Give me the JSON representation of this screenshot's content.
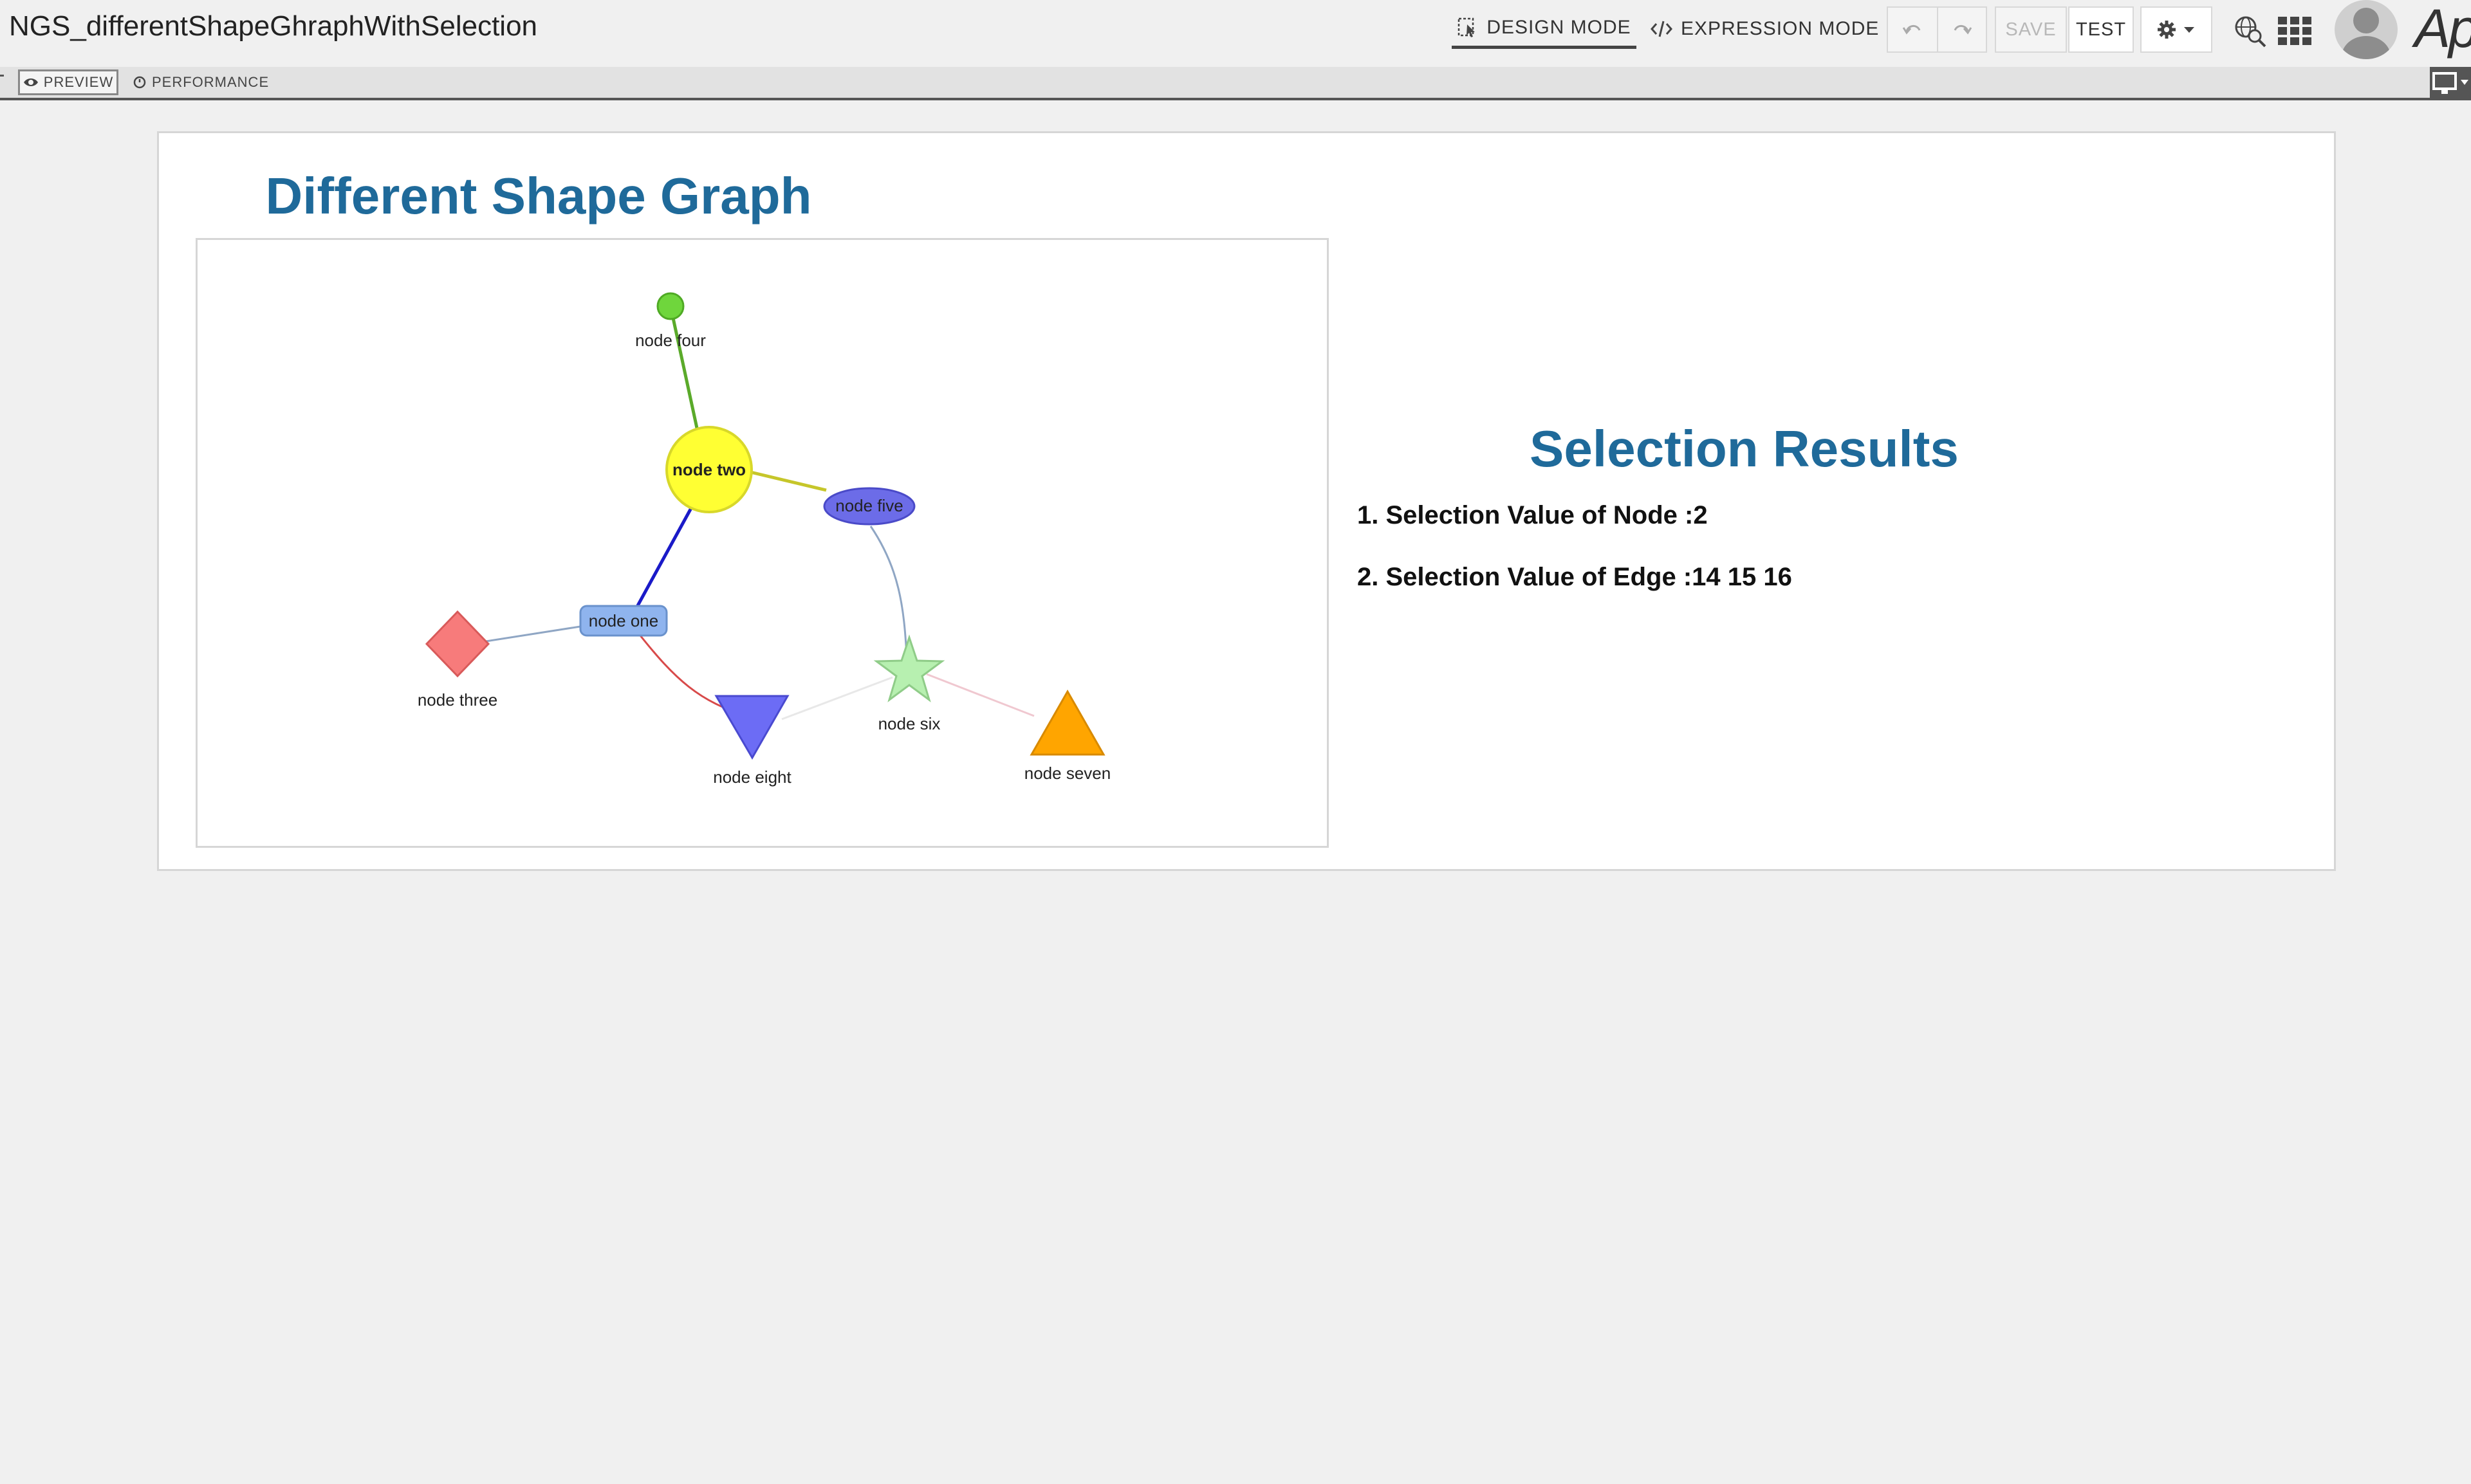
{
  "header": {
    "app_title": "NGS_differentShapeGhraphWithSelection",
    "design_mode_label": "DESIGN MODE",
    "expression_mode_label": "EXPRESSION MODE",
    "save_label": "SAVE",
    "test_label": "TEST",
    "brand_text": "App",
    "icons": [
      "undo-icon",
      "redo-icon",
      "gear-icon",
      "globe-search-icon",
      "app-grid-icon",
      "user-avatar"
    ]
  },
  "subbar": {
    "preview_label": "PREVIEW",
    "performance_label": "PERFORMANCE"
  },
  "graph": {
    "title": "Different Shape Graph",
    "nodes": [
      {
        "id": 1,
        "label": "node one",
        "shape": "round-rectangle",
        "color": "#8fb4ee"
      },
      {
        "id": 2,
        "label": "node two",
        "shape": "circle",
        "color": "#ffff33"
      },
      {
        "id": 3,
        "label": "node three",
        "shape": "diamond",
        "color": "#f77b7b"
      },
      {
        "id": 4,
        "label": "node four",
        "shape": "circle",
        "color": "#6fd63c"
      },
      {
        "id": 5,
        "label": "node five",
        "shape": "ellipse",
        "color": "#6c6ce8"
      },
      {
        "id": 6,
        "label": "node six",
        "shape": "star",
        "color": "#b7f0b0"
      },
      {
        "id": 7,
        "label": "node seven",
        "shape": "triangle",
        "color": "#ffa500"
      },
      {
        "id": 8,
        "label": "node eight",
        "shape": "inverted-triangle",
        "color": "#6c6cf5"
      }
    ],
    "edges": [
      {
        "from": 4,
        "to": 2,
        "color": "#5aaa2a"
      },
      {
        "from": 2,
        "to": 5,
        "color": "#c6c62a"
      },
      {
        "from": 2,
        "to": 1,
        "color": "#1a1ac8"
      },
      {
        "from": 5,
        "to": 6,
        "color": "#8fa6c4"
      },
      {
        "from": 3,
        "to": 1,
        "color": "#8fa6c4"
      },
      {
        "from": 1,
        "to": 8,
        "color": "#d84a4a"
      },
      {
        "from": 8,
        "to": 6,
        "color": "#e8e8e8"
      },
      {
        "from": 6,
        "to": 7,
        "color": "#f0c8d0"
      }
    ]
  },
  "results": {
    "title": "Selection Results",
    "node_line": "1. Selection Value of Node :2",
    "edge_line": "2. Selection Value of Edge :14 15 16"
  }
}
